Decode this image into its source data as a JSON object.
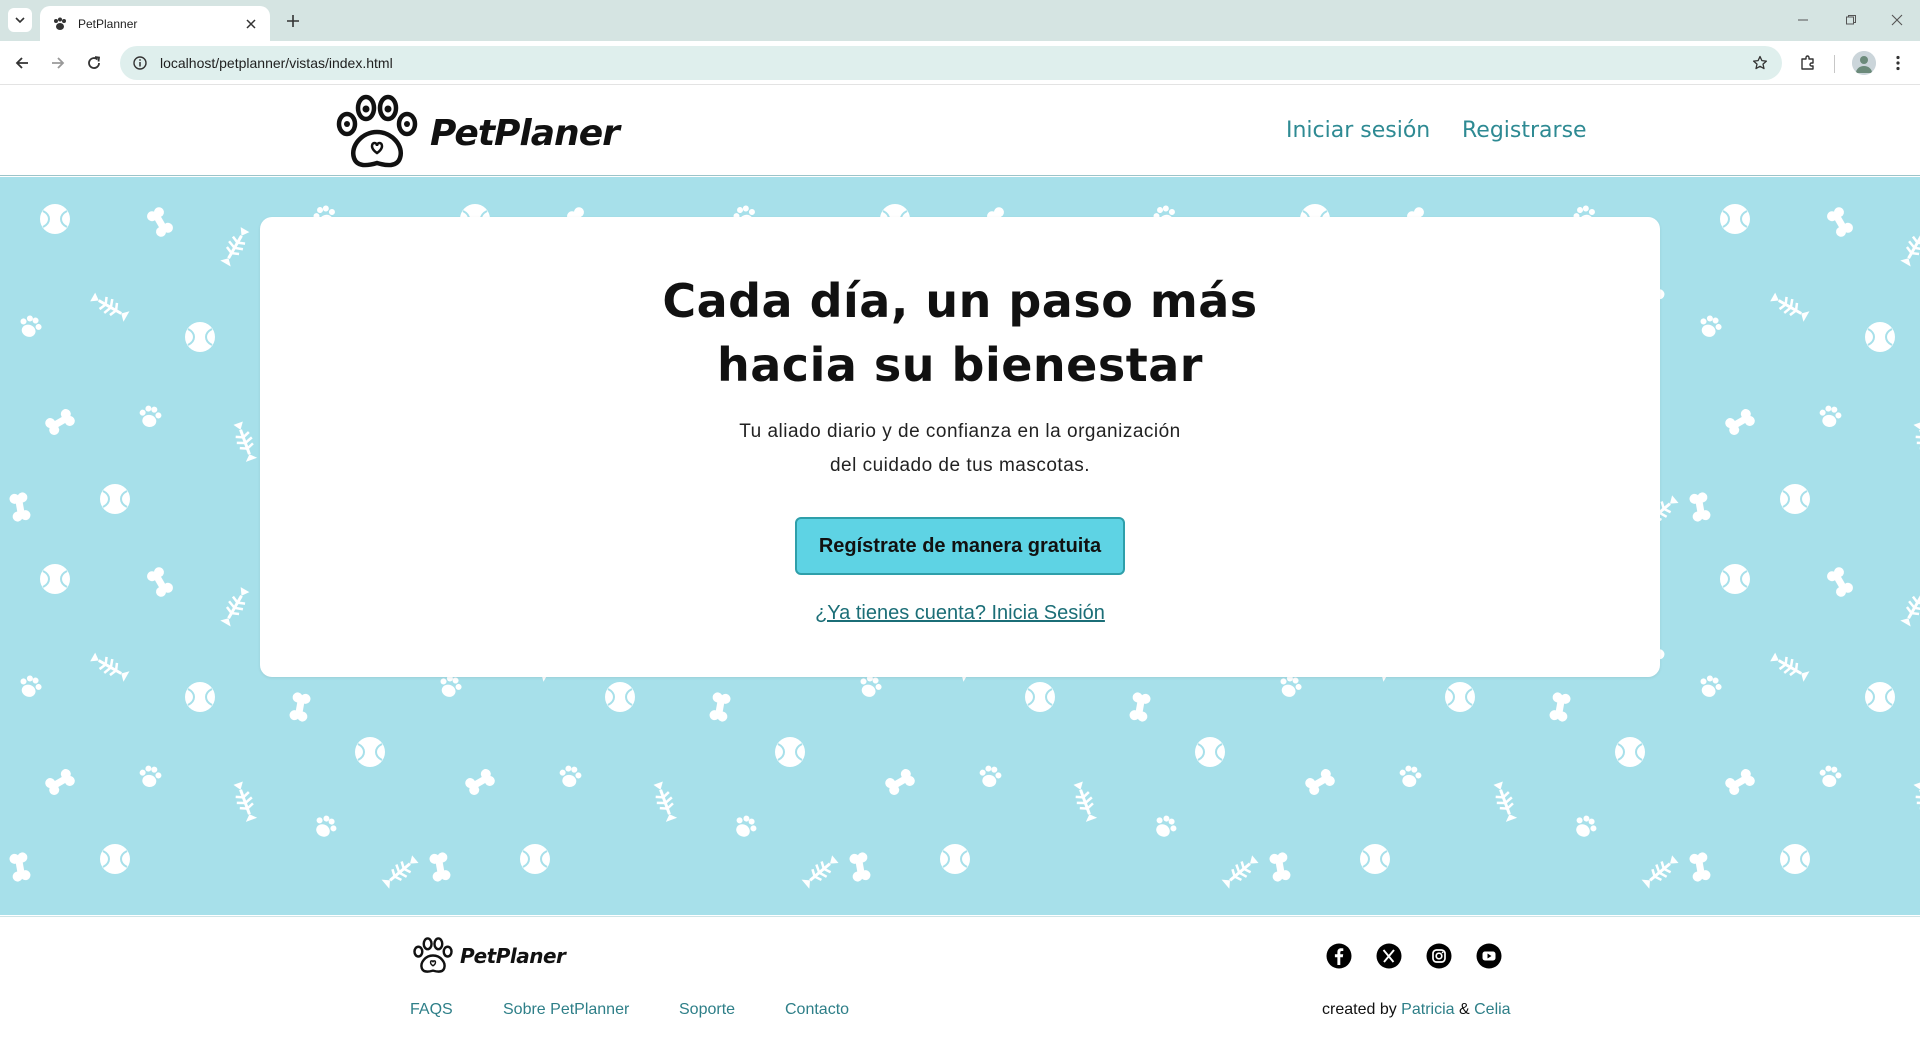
{
  "browser": {
    "tab_title": "PetPlanner",
    "url": "localhost/petplanner/vistas/index.html"
  },
  "header": {
    "logo_text": "PetPlaner",
    "login_label": "Iniciar sesión",
    "register_label": "Registrarse"
  },
  "hero": {
    "headline_line1": "Cada día, un paso más",
    "headline_line2": "hacia su bienestar",
    "subtext_line1": "Tu aliado diario y de confianza en la organización",
    "subtext_line2": "del cuidado de tus mascotas.",
    "cta_label": "Regístrate de manera gratuita",
    "login_link": "¿Ya tienes cuenta? Inicia Sesión",
    "pattern_colors": {
      "background": "#a7e0ea",
      "shapes": "#ffffff"
    }
  },
  "footer": {
    "logo_text": "PetPlaner",
    "links": [
      "FAQS",
      "Sobre PetPlanner",
      "Soporte",
      "Contacto"
    ],
    "social_icons": [
      "facebook-icon",
      "x-icon",
      "instagram-icon",
      "youtube-icon"
    ],
    "credits_prefix": "created by",
    "author1": "Patricia",
    "amp": "&",
    "author2": "Celia"
  },
  "colors": {
    "accent": "#5ed3e4",
    "link": "#2e8a93",
    "hero_bg": "#a7e0ea"
  }
}
